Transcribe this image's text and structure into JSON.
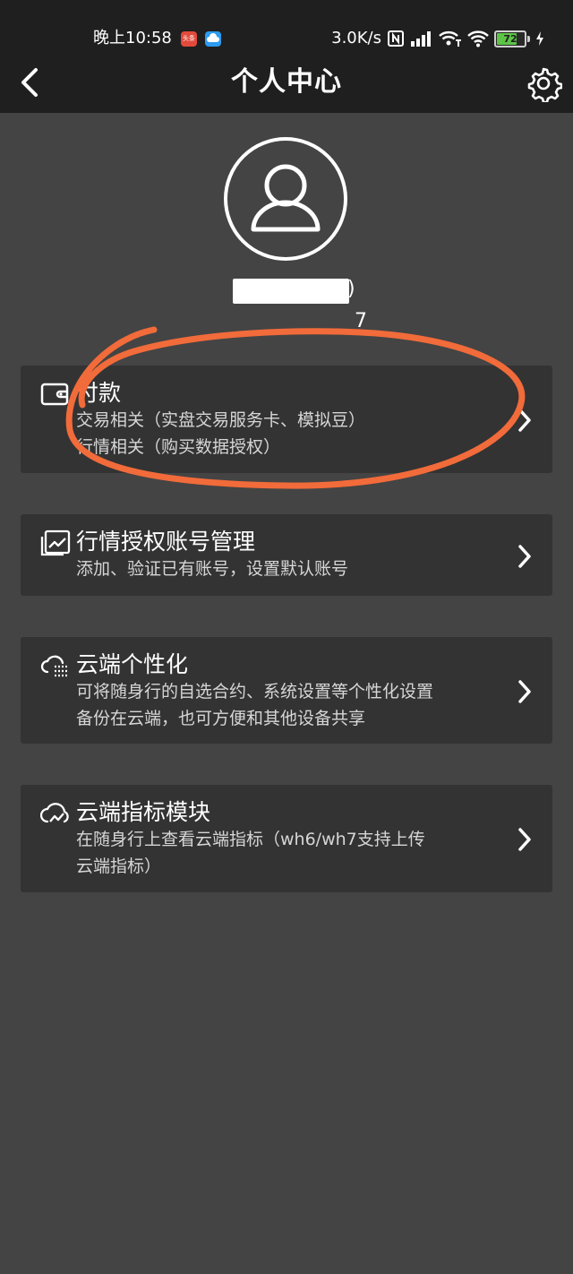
{
  "status_bar": {
    "time": "晚上10:58",
    "app_icon_1": "头条",
    "app_icon_1_color": "#e24a3b",
    "app_icon_2_color": "#2d9bf0",
    "speed": "3.0K/s",
    "battery_level": "72",
    "battery_fraction": 0.72,
    "icons": [
      "nfc-icon",
      "signal-icon",
      "wifi-calling-icon",
      "wifi-icon",
      "battery-icon",
      "charging-icon"
    ]
  },
  "nav": {
    "title": "个人中心",
    "back_icon": "back-chevron-icon",
    "settings_icon": "gear-icon"
  },
  "profile": {
    "avatar_icon": "user-avatar-icon",
    "name_tail": ")",
    "id_tail": "7"
  },
  "cards": [
    {
      "icon": "wallet-icon",
      "title": "付款",
      "desc_lines": [
        "交易相关（实盘交易服务卡、模拟豆）",
        "行情相关（购买数据授权）"
      ]
    },
    {
      "icon": "chart-window-icon",
      "title": "行情授权账号管理",
      "desc_lines": [
        "添加、验证已有账号，设置默认账号"
      ]
    },
    {
      "icon": "cloud-list-icon",
      "title": "云端个性化",
      "desc_lines": [
        "可将随身行的自选合约、系统设置等个性化设置",
        "备份在云端，也可方便和其他设备共享"
      ]
    },
    {
      "icon": "cloud-chart-icon",
      "title": "云端指标模块",
      "desc_lines": [
        "在随身行上查看云端指标（wh6/wh7支持上传",
        "云端指标）"
      ]
    }
  ],
  "colors": {
    "background": "#444444",
    "bar": "#1f1f1f",
    "card": "#333333",
    "annotation": "#f26b3a",
    "battery": "#5ec447"
  }
}
